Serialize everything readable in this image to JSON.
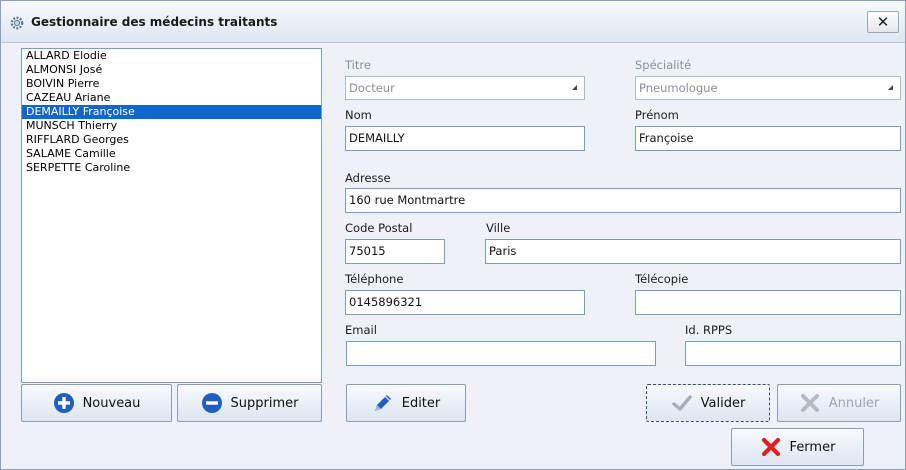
{
  "window": {
    "title": "Gestionnaire des médecins traitants",
    "close_label": "✕"
  },
  "doctors": [
    "ALLARD Elodie",
    "ALMONSI José",
    "BOIVIN Pierre",
    "CAZEAU Ariane",
    "DEMAILLY Françoise",
    "MUNSCH Thierry",
    "RIFFLARD Georges",
    "SALAME Camille",
    "SERPETTE Caroline"
  ],
  "selected_doctor": "DEMAILLY Françoise",
  "form": {
    "titre": {
      "label": "Titre",
      "value": "Docteur"
    },
    "specialite": {
      "label": "Spécialité",
      "value": "Pneumologue"
    },
    "nom": {
      "label": "Nom",
      "value": "DEMAILLY"
    },
    "prenom": {
      "label": "Prénom",
      "value": "Françoise"
    },
    "adresse": {
      "label": "Adresse",
      "value": "160 rue Montmartre"
    },
    "code_postal": {
      "label": "Code Postal",
      "value": "75015"
    },
    "ville": {
      "label": "Ville",
      "value": "Paris"
    },
    "telephone": {
      "label": "Téléphone",
      "value": "0145896321"
    },
    "telecopie": {
      "label": "Télécopie",
      "value": ""
    },
    "email": {
      "label": "Email",
      "value": ""
    },
    "rpps": {
      "label": "Id. RPPS",
      "value": ""
    }
  },
  "buttons": {
    "nouveau": "Nouveau",
    "supprimer": "Supprimer",
    "editer": "Editer",
    "valider": "Valider",
    "annuler": "Annuler",
    "fermer": "Fermer"
  },
  "colors": {
    "selection": "#0f66cc",
    "accent_blue": "#1f5fbf",
    "red_x": "#e02020"
  }
}
